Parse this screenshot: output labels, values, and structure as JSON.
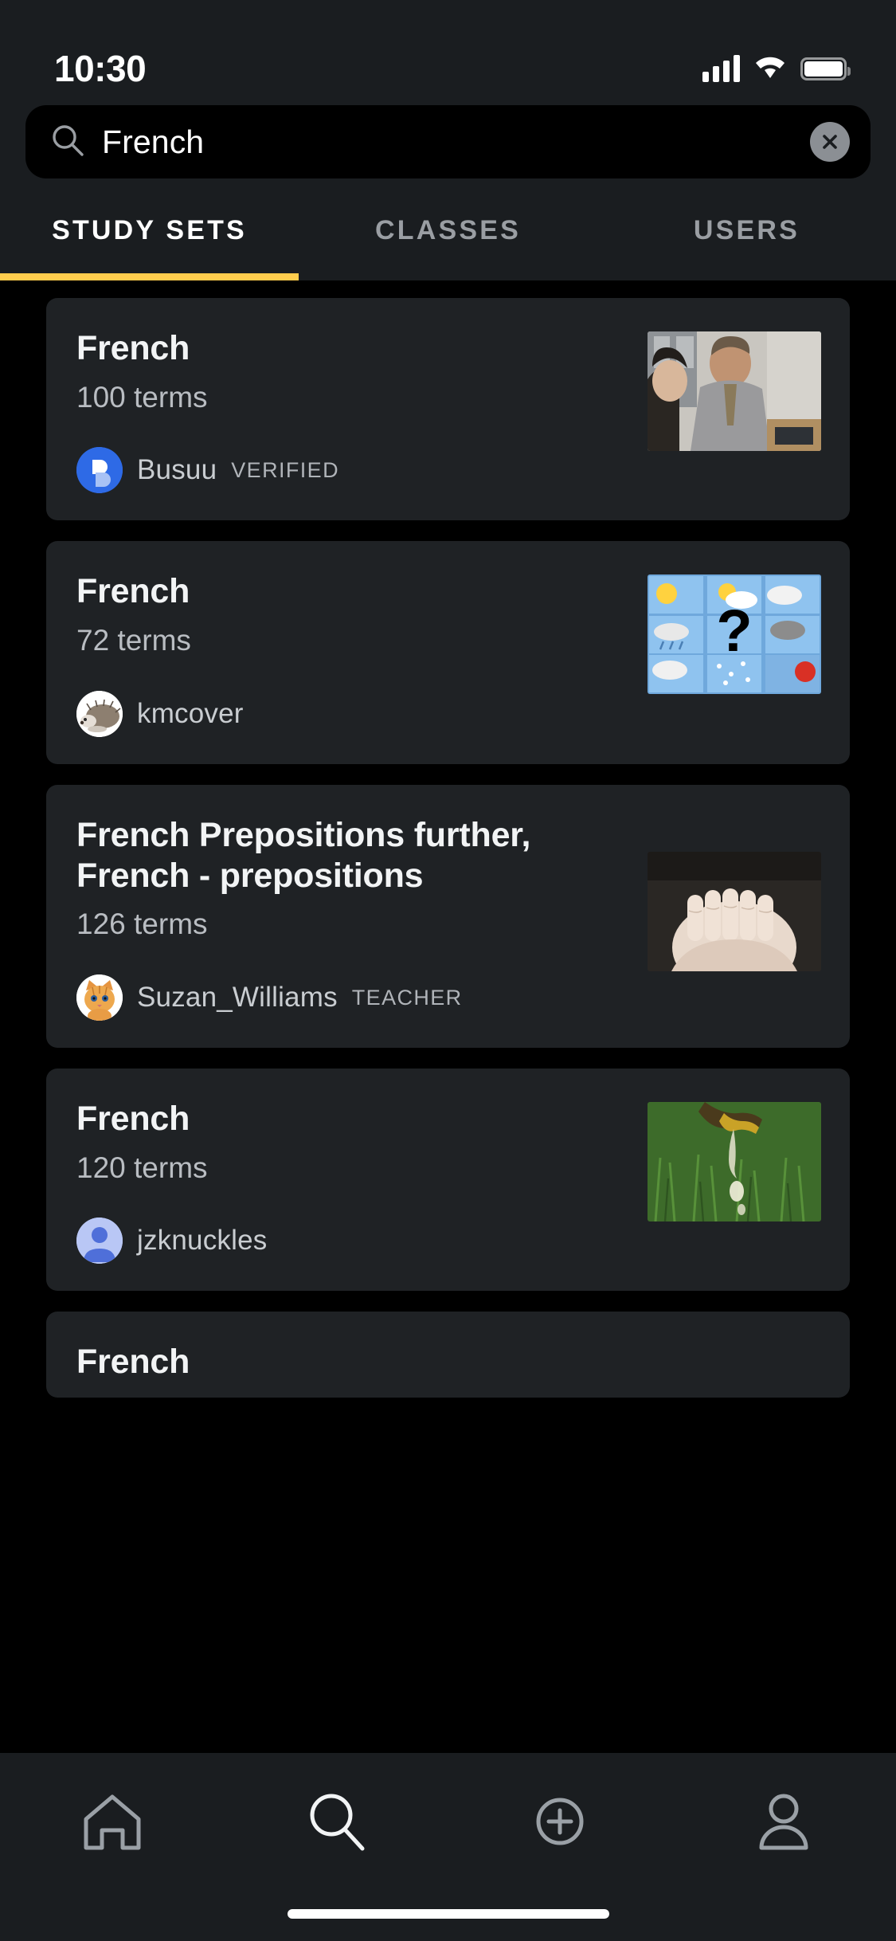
{
  "status_bar": {
    "time": "10:30",
    "signal_icon": "cellular-signal-icon",
    "wifi_icon": "wifi-icon",
    "battery_icon": "battery-icon"
  },
  "search": {
    "icon": "search-icon",
    "value": "French",
    "placeholder": "Search",
    "clear_icon": "close-circle-icon"
  },
  "tabs": [
    {
      "label": "STUDY SETS",
      "active": true
    },
    {
      "label": "CLASSES",
      "active": false
    },
    {
      "label": "USERS",
      "active": false
    }
  ],
  "accent_color": "#ffcd4d",
  "results": [
    {
      "title": "French",
      "terms": "100 terms",
      "author": "Busuu",
      "badge": "VERIFIED",
      "avatar": "busuu-logo-avatar",
      "thumbnail": "two-people-at-laptop-photo"
    },
    {
      "title": "French",
      "terms": "72 terms",
      "author": "kmcover",
      "badge": "",
      "avatar": "hedgehog-photo-avatar",
      "thumbnail": "weather-icons-grid-with-question-mark"
    },
    {
      "title": "French Prepositions further, French - prepositions",
      "terms": "126 terms",
      "author": "Suzan_Williams",
      "badge": "TEACHER",
      "avatar": "orange-kitten-photo-avatar",
      "thumbnail": "hands-covering-face-photo"
    },
    {
      "title": "French",
      "terms": "120 terms",
      "author": "jzknuckles",
      "badge": "",
      "avatar": "default-person-avatar",
      "thumbnail": "honey-dripping-on-grass-photo"
    },
    {
      "title": "French",
      "terms": "",
      "author": "",
      "badge": "",
      "avatar": "",
      "thumbnail": ""
    }
  ],
  "bottom_nav": [
    {
      "icon": "home-icon",
      "active": false
    },
    {
      "icon": "search-icon",
      "active": true
    },
    {
      "icon": "plus-circle-icon",
      "active": false
    },
    {
      "icon": "person-icon",
      "active": false
    }
  ],
  "home_indicator": "home-indicator"
}
